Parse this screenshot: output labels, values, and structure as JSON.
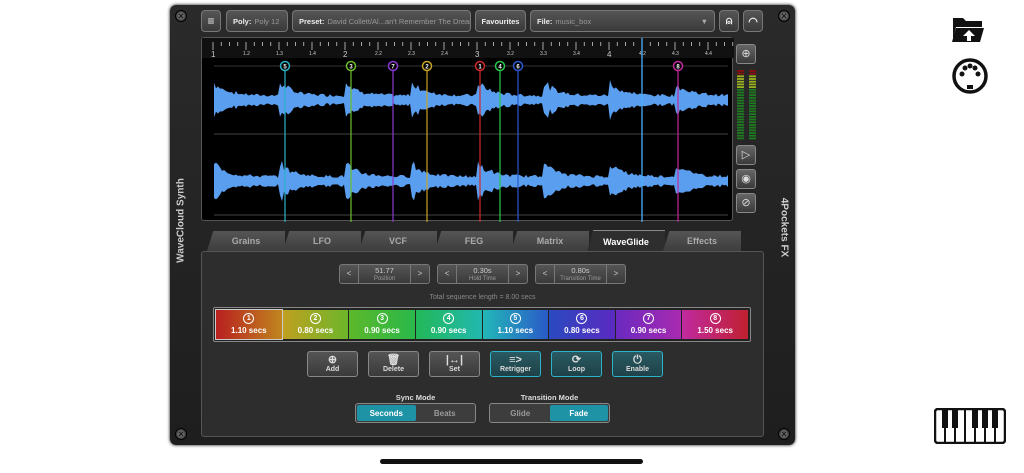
{
  "toolbar": {
    "menu_icon": "hamburger-icon",
    "poly_label": "Poly:",
    "poly_value": "Poly 12",
    "preset_label": "Preset:",
    "preset_value": "David Collett/Al...an't Remember The Dream",
    "favourites": "Favourites",
    "file_label": "File:",
    "file_value": "music_box"
  },
  "side_labels": {
    "left": "WaveCloud Synth",
    "right": "4Pockets FX"
  },
  "ruler": {
    "labels": [
      "1",
      "1.2",
      "1.3",
      "1.4",
      "2",
      "2.2",
      "2.3",
      "2.4",
      "3",
      "3.2",
      "3.3",
      "3.4",
      "4",
      "4.2",
      "4.3",
      "4.4"
    ]
  },
  "markers": [
    {
      "n": "5",
      "color": "#2bb3c8"
    },
    {
      "n": "3",
      "color": "#6cbf2a"
    },
    {
      "n": "7",
      "color": "#8a3ad0"
    },
    {
      "n": "2",
      "color": "#c8a428"
    },
    {
      "n": "1",
      "color": "#d02a2a"
    },
    {
      "n": "4",
      "color": "#2ac84a"
    },
    {
      "n": "6",
      "color": "#2a5ad0"
    },
    {
      "n": "8",
      "color": "#c02aa0"
    }
  ],
  "playhead_color": "#4ab0ff",
  "tabs": [
    "Grains",
    "LFO",
    "VCF",
    "FEG",
    "Matrix",
    "WaveGlide",
    "Effects"
  ],
  "active_tab": "WaveGlide",
  "steppers": [
    {
      "value": "51.77",
      "label": "Position"
    },
    {
      "value": "0.30s",
      "label": "Hold Time"
    },
    {
      "value": "0.80s",
      "label": "Transition Time"
    }
  ],
  "total_length": "Total sequence length = 8.00 secs",
  "sequence": [
    {
      "n": "1",
      "dur": "1.10 secs"
    },
    {
      "n": "2",
      "dur": "0.80 secs"
    },
    {
      "n": "3",
      "dur": "0.90 secs"
    },
    {
      "n": "4",
      "dur": "0.90 secs"
    },
    {
      "n": "5",
      "dur": "1.10 secs"
    },
    {
      "n": "6",
      "dur": "0.80 secs"
    },
    {
      "n": "7",
      "dur": "0.90 secs"
    },
    {
      "n": "8",
      "dur": "1.50 secs"
    }
  ],
  "actions": [
    {
      "label": "Add",
      "icon": "⊕"
    },
    {
      "label": "Delete",
      "icon": "🗑"
    },
    {
      "label": "Set",
      "icon": "|↔|"
    },
    {
      "label": "Retrigger",
      "icon": "≡>"
    },
    {
      "label": "Loop",
      "icon": "⟳"
    },
    {
      "label": "Enable",
      "icon": "⏻"
    }
  ],
  "sync_mode": {
    "title": "Sync Mode",
    "options": [
      "Seconds",
      "Beats"
    ],
    "selected": "Seconds"
  },
  "transition_mode": {
    "title": "Transition Mode",
    "options": [
      "Glide",
      "Fade"
    ],
    "selected": "Fade"
  }
}
